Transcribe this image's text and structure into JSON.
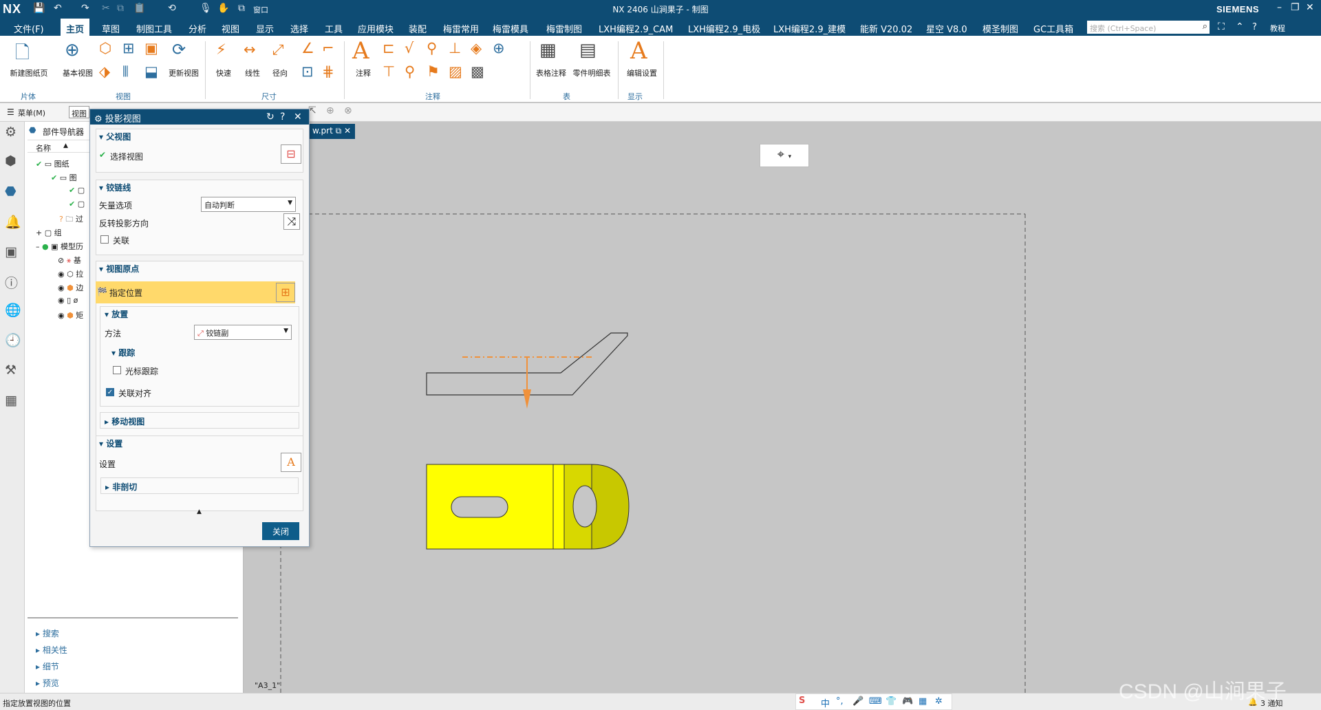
{
  "app": {
    "logo": "NX",
    "title": "NX 2406 山涧果子 - 制图",
    "brand": "SIEMENS",
    "window_menu": "窗口",
    "min": "–",
    "restore": "❐",
    "close": "✕"
  },
  "menu": {
    "file": "文件(F)",
    "tabs": [
      "主页",
      "草图",
      "制图工具",
      "分析",
      "视图",
      "显示",
      "选择",
      "工具",
      "应用模块",
      "装配",
      "梅雷常用",
      "梅雷模具",
      "梅雷制图",
      "LXH编程2.9_CAM",
      "LXH编程2.9_电极",
      "LXH编程2.9_建模",
      "能新 V20.02",
      "星空 V8.0",
      "模圣制图",
      "GC工具箱"
    ],
    "search_placeholder": "搜索 (Ctrl+Space)",
    "tutorial": "教程"
  },
  "ribbon": {
    "new_sheet": "新建图纸页",
    "base_view": "基本视图",
    "update_view": "更新视图",
    "quick": "快速",
    "linear": "线性",
    "radial": "径向",
    "annotation": "注释",
    "table_note": "表格注释",
    "parts_list": "零件明细表",
    "edit_settings": "编辑设置",
    "group_sheet": "片体",
    "group_view": "视图",
    "group_dim": "尺寸",
    "group_ann": "注释",
    "group_table": "表",
    "group_display": "显示"
  },
  "toolbar2": {
    "menu": "菜单(M)",
    "filter": "视图"
  },
  "tab": {
    "file": "w.prt"
  },
  "nav": {
    "title": "部件导航器",
    "col_name": "名称",
    "nodes": [
      "图纸",
      "图",
      "",
      "",
      "过",
      "组",
      "模型历",
      "基",
      "拉",
      "边",
      "ø",
      "矩"
    ],
    "sections": [
      "搜索",
      "相关性",
      "细节",
      "预览"
    ]
  },
  "dialog": {
    "title": "投影视图",
    "parent_view": "父视图",
    "select_view": "选择视图",
    "hinge_line": "铰链线",
    "vector_option": "矢量选项",
    "vector_value": "自动判断",
    "reverse_dir": "反转投影方向",
    "associative": "关联",
    "view_origin": "视图原点",
    "specify_location": "指定位置",
    "placement": "放置",
    "method": "方法",
    "method_value": "铰链副",
    "tracking": "跟踪",
    "cursor_tracking": "光标跟踪",
    "assoc_align": "关联对齐",
    "move_view": "移动视图",
    "settings": "设置",
    "settings_label": "设置",
    "non_section": "非剖切",
    "close": "关闭"
  },
  "canvas": {
    "sheet_label": "\"A3_1\""
  },
  "status": {
    "message": "指定放置视图的位置",
    "notifications": "3 通知"
  },
  "ime": {
    "items": [
      "S",
      "中",
      "°,",
      "🎤",
      "⌨",
      "👕",
      "🎮",
      "▦",
      "✲"
    ]
  },
  "watermark": "CSDN @山涧果子",
  "colors": {
    "titlebar": "#0e4c74",
    "part_yellow": "#ffff00",
    "hinge_orange": "#f0913a",
    "highlight": "#ffd96b"
  }
}
